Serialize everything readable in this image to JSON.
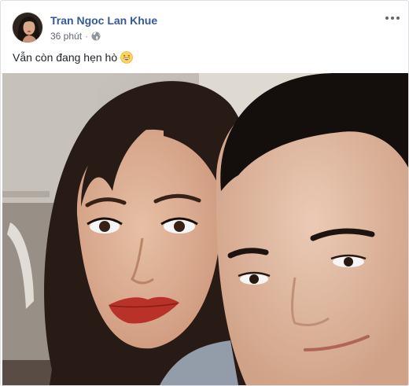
{
  "post": {
    "author_name": "Tran Ngoc Lan Khue",
    "timestamp": "36 phút",
    "separator": "·",
    "privacy_icon": "globe-icon",
    "more_icon": "more-options-icon",
    "text": "Vẫn còn đang hẹn hò",
    "emoji": "grinning-face-emoji"
  },
  "photo": {
    "subject": "couple-selfie"
  },
  "colors": {
    "author_link": "#365899",
    "meta_text": "#616770",
    "border": "#dddfe2",
    "lipstick": "#c0352b"
  }
}
